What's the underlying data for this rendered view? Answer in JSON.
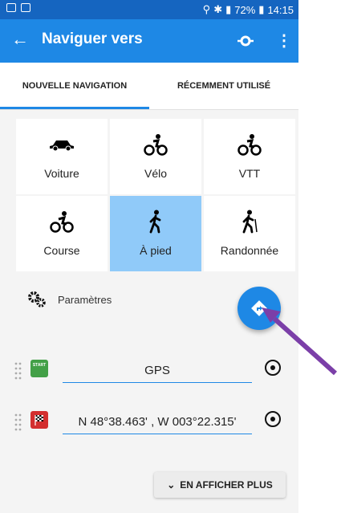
{
  "status_bar": {
    "battery": "72%",
    "time": "14:15"
  },
  "app_bar": {
    "title": "Naviguer vers"
  },
  "tabs": [
    {
      "label": "NOUVELLE NAVIGATION",
      "active": true
    },
    {
      "label": "RÉCEMMENT UTILISÉ",
      "active": false
    }
  ],
  "modes": [
    {
      "label": "Voiture",
      "icon": "car-icon"
    },
    {
      "label": "Vélo",
      "icon": "bike-icon"
    },
    {
      "label": "VTT",
      "icon": "mountain-bike-icon"
    },
    {
      "label": "Course",
      "icon": "road-bike-icon"
    },
    {
      "label": "À pied",
      "icon": "walking-icon",
      "selected": true
    },
    {
      "label": "Randonnée",
      "icon": "hiking-icon"
    }
  ],
  "settings": {
    "label": "Paramètres"
  },
  "route": {
    "start": {
      "value": "GPS",
      "flag_label": "START"
    },
    "destination": {
      "value": "N 48°38.463' , W 003°22.315'"
    }
  },
  "more_button": {
    "label": "EN AFFICHER PLUS"
  },
  "colors": {
    "primary": "#1e88e5",
    "status_bar": "#1565c0",
    "selected_mode": "#90caf9",
    "arrow": "#7b3fa8"
  }
}
